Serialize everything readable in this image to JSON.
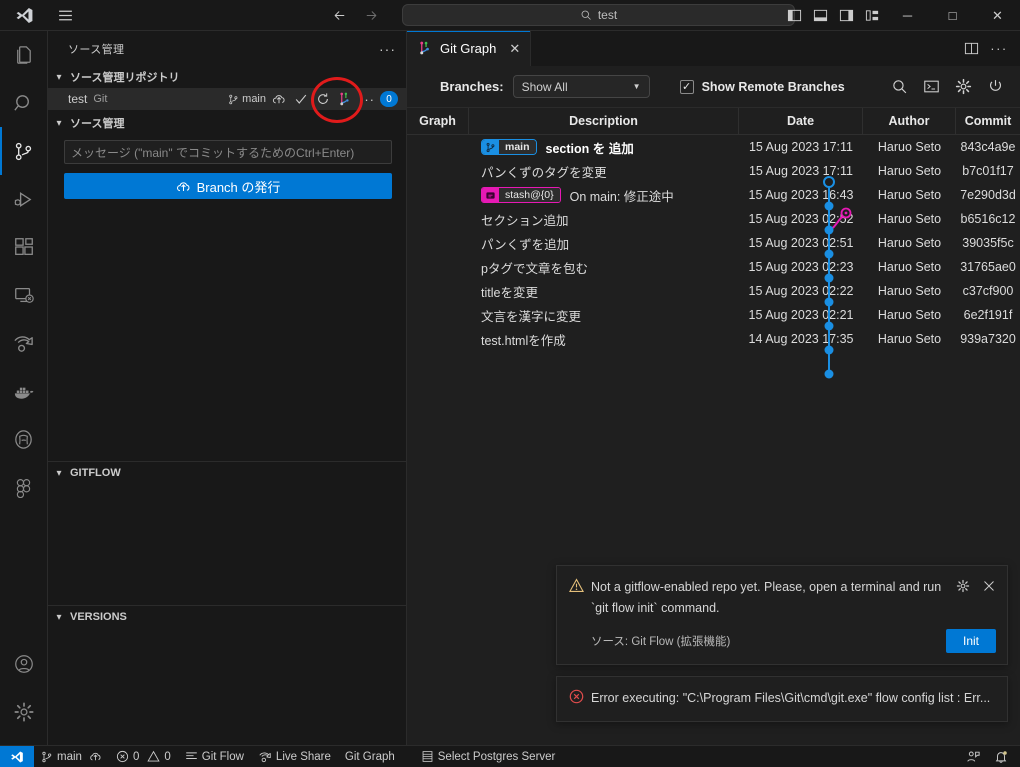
{
  "titlebar": {
    "logo": "vscode-logo-icon",
    "menu_icon": "hamburger-menu-icon",
    "back_icon": "arrow-left-icon",
    "forward_icon": "arrow-right-icon",
    "search_value": "test",
    "search_icon": "search-icon",
    "layout_icons": [
      "toggle-primary-sidebar-icon",
      "toggle-panel-icon",
      "toggle-secondary-sidebar-icon",
      "customize-layout-icon"
    ],
    "minimize": "─",
    "maximize": "□",
    "close": "✕"
  },
  "activitybar": {
    "items": [
      {
        "name": "explorer",
        "icon": "files-icon",
        "active": false
      },
      {
        "name": "search",
        "icon": "search-icon",
        "active": false
      },
      {
        "name": "source-control",
        "icon": "source-control-icon",
        "active": true
      },
      {
        "name": "run-and-debug",
        "icon": "debug-icon",
        "active": false
      },
      {
        "name": "extensions",
        "icon": "extensions-icon",
        "active": false
      },
      {
        "name": "remote-explorer",
        "icon": "remote-explorer-icon",
        "active": false
      },
      {
        "name": "live-share",
        "icon": "live-share-icon",
        "active": false
      },
      {
        "name": "docker",
        "icon": "docker-icon",
        "active": false
      },
      {
        "name": "postgresql",
        "icon": "postgresql-icon",
        "active": false
      },
      {
        "name": "figma",
        "icon": "figma-icon",
        "active": false
      }
    ],
    "bottom": [
      {
        "name": "accounts",
        "icon": "account-icon"
      },
      {
        "name": "manage",
        "icon": "gear-icon"
      }
    ]
  },
  "sidebar": {
    "title": "ソース管理",
    "more_label": "···",
    "repos_section": {
      "label": "ソース管理リポジトリ",
      "repo": {
        "name": "test",
        "type": "Git",
        "branch": "main",
        "actions": [
          "publish-branch-icon",
          "commit-check-icon",
          "refresh-icon",
          "git-graph-icon",
          "more-actions-icon"
        ],
        "badge": "0"
      }
    },
    "scm_section": {
      "label": "ソース管理",
      "input_placeholder": "メッセージ (\"main\" でコミットするためのCtrl+Enter)",
      "publish_button": "Branch の発行",
      "publish_icon": "cloud-upload-icon"
    },
    "gitflow_section": {
      "label": "GITFLOW"
    },
    "versions_section": {
      "label": "VERSIONS"
    }
  },
  "editor": {
    "tab": {
      "label": "Git Graph",
      "icon": "git-graph-icon",
      "close": "✕"
    },
    "tab_actions": [
      "split-editor-right-icon",
      "more-actions-icon"
    ]
  },
  "gitgraph": {
    "branches_label": "Branches:",
    "branches_value": "Show All",
    "show_remote_label": "Show Remote Branches",
    "show_remote_checked": true,
    "toolbar_icons": [
      "search-icon",
      "terminal-icon",
      "gear-icon",
      "refresh-icon"
    ],
    "columns": [
      "Graph",
      "Description",
      "Date",
      "Author",
      "Commit"
    ],
    "commits": [
      {
        "refs": [
          {
            "type": "branch",
            "label": "main",
            "icon": "branch-icon"
          }
        ],
        "description": "section を 追加",
        "bold": true,
        "date": "15 Aug 2023 17:11",
        "author": "Haruo Seto",
        "commit": "843c4a9e"
      },
      {
        "refs": [],
        "description": "パンくずのタグを変更",
        "bold": false,
        "date": "15 Aug 2023 17:11",
        "author": "Haruo Seto",
        "commit": "b7c01f17"
      },
      {
        "refs": [
          {
            "type": "stash",
            "label": "stash@{0}",
            "icon": "stash-icon"
          }
        ],
        "description": "On main: 修正途中",
        "bold": false,
        "date": "15 Aug 2023 16:43",
        "author": "Haruo Seto",
        "commit": "7e290d3d"
      },
      {
        "refs": [],
        "description": "セクション追加",
        "bold": false,
        "date": "15 Aug 2023 02:52",
        "author": "Haruo Seto",
        "commit": "b6516c12"
      },
      {
        "refs": [],
        "description": "パンくずを追加",
        "bold": false,
        "date": "15 Aug 2023 02:51",
        "author": "Haruo Seto",
        "commit": "39035f5c"
      },
      {
        "refs": [],
        "description": "pタグで文章を包む",
        "bold": false,
        "date": "15 Aug 2023 02:23",
        "author": "Haruo Seto",
        "commit": "31765ae0"
      },
      {
        "refs": [],
        "description": "titleを変更",
        "bold": false,
        "date": "15 Aug 2023 02:22",
        "author": "Haruo Seto",
        "commit": "c37cf900"
      },
      {
        "refs": [],
        "description": "文言を漢字に変更",
        "bold": false,
        "date": "15 Aug 2023 02:21",
        "author": "Haruo Seto",
        "commit": "6e2f191f"
      },
      {
        "refs": [],
        "description": "test.htmlを作成",
        "bold": false,
        "date": "14 Aug 2023 17:35",
        "author": "Haruo Seto",
        "commit": "939a7320"
      }
    ],
    "colors": {
      "branch_line": "#1a8fe3",
      "stash_line": "#e619b4"
    }
  },
  "notifications": [
    {
      "severity": "warning",
      "icon": "warning-icon",
      "message": "Not a gitflow-enabled repo yet. Please, open a terminal and run `git flow init` command.",
      "source": "ソース: Git Flow (拡張機能)",
      "actions": [
        "gear-icon",
        "close-icon"
      ],
      "button": "Init"
    },
    {
      "severity": "error",
      "icon": "error-icon",
      "message": "Error executing: \"C:\\Program Files\\Git\\cmd\\git.exe\" flow config list : Err...",
      "source": "",
      "actions": [],
      "button": ""
    }
  ],
  "statusbar": {
    "remote_icon": "remote-window-icon",
    "left_items": [
      {
        "name": "branch",
        "icon": "branch-icon",
        "label": "main",
        "trailing_icon": "cloud-upload-icon"
      },
      {
        "name": "problems",
        "icon": "error-icon",
        "label": "0",
        "second_icon": "warning-icon",
        "second_label": "0"
      },
      {
        "name": "git-flow",
        "icon": "list-icon",
        "label": "Git Flow"
      },
      {
        "name": "live-share",
        "icon": "live-share-icon",
        "label": "Live Share"
      },
      {
        "name": "git-graph",
        "icon": "",
        "label": "Git Graph"
      },
      {
        "name": "postgres",
        "icon": "database-icon",
        "label": "Select Postgres Server"
      }
    ],
    "right_items": [
      {
        "name": "feedback",
        "icon": "feedback-icon"
      },
      {
        "name": "notifications",
        "icon": "bell-dot-icon"
      }
    ]
  }
}
